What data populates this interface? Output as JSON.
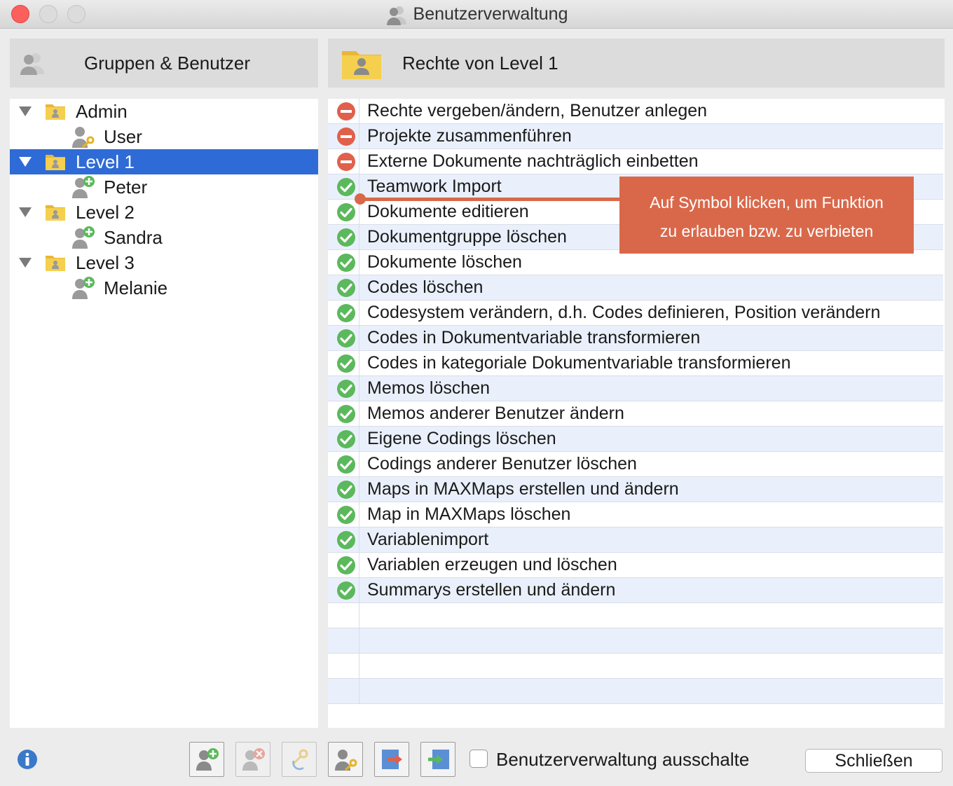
{
  "window": {
    "title": "Benutzerverwaltung",
    "controls": [
      "close",
      "minimize",
      "maximize"
    ]
  },
  "left_panel": {
    "header": "Gruppen & Benutzer",
    "header_icon": "users-icon",
    "tree": [
      {
        "type": "group",
        "label": "Admin",
        "expanded": true,
        "selected": false
      },
      {
        "type": "user",
        "label": "User",
        "icon": "user-key-icon"
      },
      {
        "type": "group",
        "label": "Level 1",
        "expanded": true,
        "selected": true
      },
      {
        "type": "user",
        "label": "Peter",
        "icon": "user-add-icon"
      },
      {
        "type": "group",
        "label": "Level 2",
        "expanded": true,
        "selected": false
      },
      {
        "type": "user",
        "label": "Sandra",
        "icon": "user-add-icon"
      },
      {
        "type": "group",
        "label": "Level 3",
        "expanded": true,
        "selected": false
      },
      {
        "type": "user",
        "label": "Melanie",
        "icon": "user-add-icon"
      }
    ]
  },
  "right_panel": {
    "header": "Rechte von Level 1",
    "header_icon": "group-folder-icon",
    "rights": [
      {
        "label": "Rechte vergeben/ändern, Benutzer anlegen",
        "status": "denied"
      },
      {
        "label": "Projekte zusammenführen",
        "status": "denied"
      },
      {
        "label": "Externe Dokumente nachträglich einbetten",
        "status": "denied"
      },
      {
        "label": "Teamwork Import",
        "status": "allowed"
      },
      {
        "label": "Dokumente editieren",
        "status": "allowed"
      },
      {
        "label": "Dokumentgruppe löschen",
        "status": "allowed"
      },
      {
        "label": "Dokumente löschen",
        "status": "allowed"
      },
      {
        "label": "Codes löschen",
        "status": "allowed"
      },
      {
        "label": "Codesystem verändern, d.h. Codes definieren, Position verändern",
        "status": "allowed"
      },
      {
        "label": "Codes in Dokumentvariable transformieren",
        "status": "allowed"
      },
      {
        "label": "Codes in kategoriale Dokumentvariable transformieren",
        "status": "allowed"
      },
      {
        "label": "Memos löschen",
        "status": "allowed"
      },
      {
        "label": "Memos anderer Benutzer ändern",
        "status": "allowed"
      },
      {
        "label": "Eigene Codings löschen",
        "status": "allowed"
      },
      {
        "label": "Codings anderer Benutzer löschen",
        "status": "allowed"
      },
      {
        "label": "Maps in MAXMaps erstellen und ändern",
        "status": "allowed"
      },
      {
        "label": "Map in MAXMaps löschen",
        "status": "allowed"
      },
      {
        "label": "Variablenimport",
        "status": "allowed"
      },
      {
        "label": "Variablen erzeugen und löschen",
        "status": "allowed"
      },
      {
        "label": "Summarys erstellen und ändern",
        "status": "allowed"
      }
    ],
    "empty_rows": 4
  },
  "callout": {
    "line1": "Auf Symbol klicken, um Funktion",
    "line2": "zu erlauben bzw. zu verbieten",
    "color": "#d9684a"
  },
  "toolbar": {
    "buttons": [
      {
        "name": "add-user-button",
        "icon": "user-add-icon",
        "enabled": true
      },
      {
        "name": "delete-user-button",
        "icon": "user-delete-icon",
        "enabled": false
      },
      {
        "name": "change-password-button",
        "icon": "key-refresh-icon",
        "enabled": false
      },
      {
        "name": "user-password-button",
        "icon": "user-key-icon",
        "enabled": true
      },
      {
        "name": "export-button",
        "icon": "export-icon",
        "enabled": true
      },
      {
        "name": "import-button",
        "icon": "import-icon",
        "enabled": true
      }
    ],
    "checkbox_label": "Benutzerverwaltung ausschalte",
    "checkbox_checked": false,
    "close_label": "Schließen"
  },
  "colors": {
    "selection": "#2f6bd6",
    "allowed": "#5cb85c",
    "denied": "#e0604c",
    "folder": "#f2c94c"
  }
}
